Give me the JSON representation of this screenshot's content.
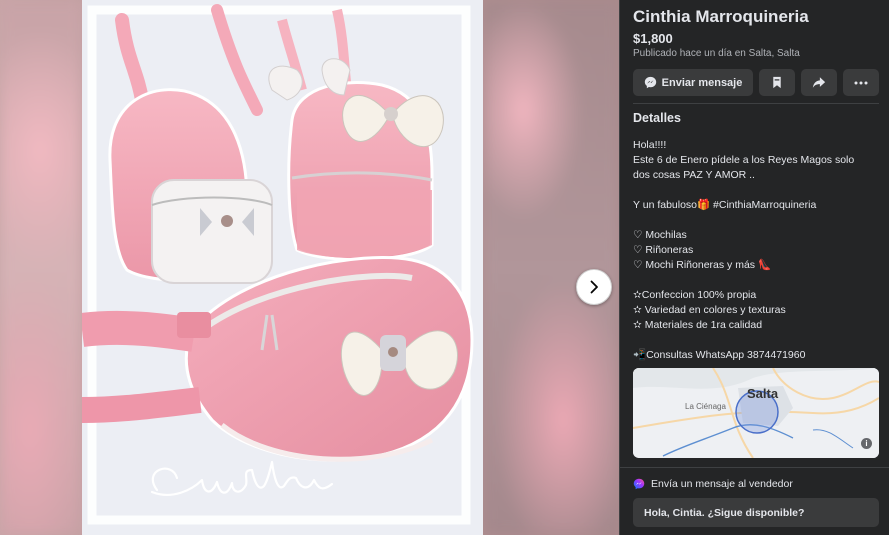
{
  "listing": {
    "title": "Cinthia Marroquineria",
    "price": "$1,800",
    "published": "Publicado hace un día en Salta, Salta"
  },
  "actions": {
    "message_label": "Enviar mensaje",
    "save_icon": "bookmark-icon",
    "share_icon": "share-icon",
    "more_icon": "more-icon"
  },
  "details": {
    "heading": "Detalles",
    "lines": [
      "Hola!!!!",
      "      Este 6 de Enero pídele a los Reyes Magos solo",
      "dos cosas  PAZ Y AMOR ..",
      "",
      " Y un fabuloso🎁  #CinthiaMarroquineria",
      "",
      "♡ Mochilas",
      "♡ Riñoneras",
      "♡ Mochi Riñoneras y más 👠",
      "",
      "✫Confeccion 100% propia",
      "✫ Variedad en colores y texturas",
      "✫ Materiales de 1ra calidad",
      "",
      "📲Consultas WhatsApp 3874471960"
    ]
  },
  "map": {
    "city": "Salta",
    "area": "La Ciénaga",
    "info_icon": "info-icon"
  },
  "seller_contact": {
    "label": "Envía un mensaje al vendedor",
    "input_value": "Hola, Cintia. ¿Sigue disponible?"
  },
  "photo": {
    "watermark": "Cinthia"
  },
  "colors": {
    "panel_bg": "#242526",
    "button_bg": "#3a3b3c",
    "text_primary": "#e4e6eb",
    "text_secondary": "#b0b3b8",
    "product_pink": "#f2a7b6",
    "messenger_blue": "#0a7cff"
  }
}
